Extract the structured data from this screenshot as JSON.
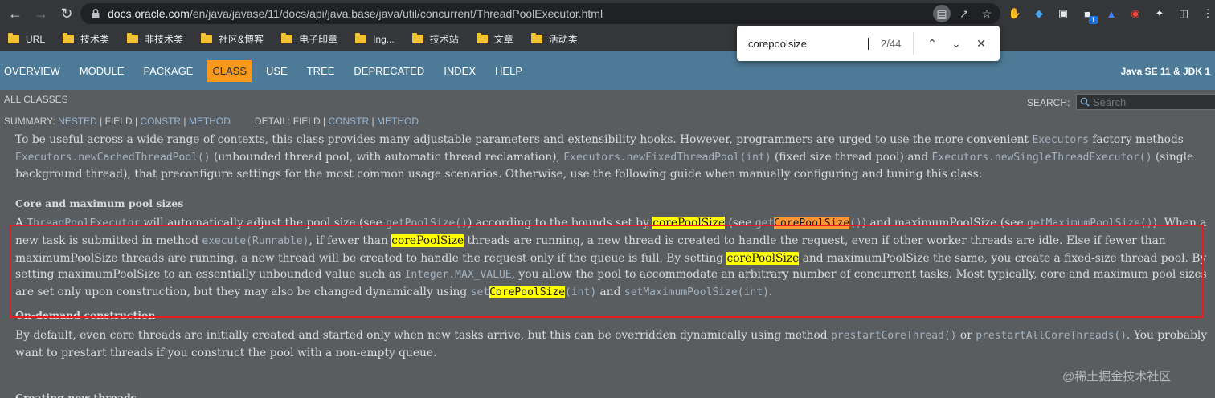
{
  "browser": {
    "url_host": "docs.oracle.com",
    "url_path": "/en/java/javase/11/docs/api/java.base/java/util/concurrent/ThreadPoolExecutor.html",
    "bookmarks": [
      "URL",
      "技术类",
      "非技术类",
      "社区&博客",
      "电子印章",
      "Ing...",
      "技术站",
      "文章",
      "活动类"
    ],
    "ext_badge": "1"
  },
  "find": {
    "query": "corepoolsize",
    "count": "2/44"
  },
  "nav": {
    "items": [
      "OVERVIEW",
      "MODULE",
      "PACKAGE",
      "CLASS",
      "USE",
      "TREE",
      "DEPRECATED",
      "INDEX",
      "HELP"
    ],
    "active": "CLASS",
    "title": "Java SE 11 & JDK 1"
  },
  "subnav": {
    "all_classes": "ALL CLASSES",
    "search_label": "SEARCH:",
    "search_placeholder": "Search",
    "summary_prefix": "SUMMARY: ",
    "summary_nested": "NESTED",
    "summary_field": "FIELD",
    "summary_constr": "CONSTR",
    "summary_method": "METHOD",
    "detail_prefix": "DETAIL: ",
    "detail_field": "FIELD",
    "detail_constr": "CONSTR",
    "detail_method": "METHOD"
  },
  "content": {
    "p1_a": "To be useful across a wide range of contexts, this class provides many adjustable parameters and extensibility hooks. However, programmers are urged to use the more convenient ",
    "p1_code1": "Executors",
    "p1_b": " factory methods ",
    "p1_code2": "Executors.newCachedThreadPool()",
    "p1_c": " (unbounded thread pool, with automatic thread reclamation), ",
    "p1_code3": "Executors.newFixedThreadPool(int)",
    "p1_d": " (fixed size thread pool) and ",
    "p1_code4": "Executors.newSingleThreadExecutor()",
    "p1_e": " (single background thread), that preconfigure settings for the most common usage scenarios. Otherwise, use the following guide when manually configuring and tuning this class:",
    "h_core": "Core and maximum pool sizes",
    "p2_a": "A ",
    "p2_code1": "ThreadPoolExecutor",
    "p2_b": " will automatically adjust the pool size (see ",
    "p2_code2": "getPoolSize()",
    "p2_c": ") according to the bounds set by ",
    "p2_hl1": "corePoolSize",
    "p2_d": " (see ",
    "p2_code3a": "get",
    "p2_hl2": "CorePoolSize",
    "p2_code3b": "()",
    "p2_e": ") and maximumPoolSize (see ",
    "p2_code4": "getMaximumPoolSize()",
    "p2_f": "). When a new task is submitted in method ",
    "p2_code5": "execute(Runnable)",
    "p2_g": ", if fewer than ",
    "p2_hl3": "corePoolSize",
    "p2_h": " threads are running, a new thread is created to handle the request, even if other worker threads are idle. Else if fewer than maximumPoolSize threads are running, a new thread will be created to handle the request only if the queue is full. By setting ",
    "p2_hl4": "corePoolSize",
    "p2_i": " and maximumPoolSize the same, you create a fixed-size thread pool. By setting maximumPoolSize to an essentially unbounded value such as ",
    "p2_code6": "Integer.MAX_VALUE",
    "p2_j": ", you allow the pool to accommodate an arbitrary number of concurrent tasks. Most typically, core and maximum pool sizes are set only upon construction, but they may also be changed dynamically using ",
    "p2_code7a": "set",
    "p2_hl5": "CorePoolSize",
    "p2_code7b": "(int)",
    "p2_k": " and ",
    "p2_code8": "setMaximumPoolSize(int)",
    "p2_l": ".",
    "h_ondemand": "On-demand construction",
    "p3_a": "By default, even core threads are initially created and started only when new tasks arrive, but this can be overridden dynamically using method ",
    "p3_code1": "prestartCoreThread()",
    "p3_b": " or ",
    "p3_code2": "prestartAllCoreThreads()",
    "p3_c": ". You probably want to prestart threads if you construct the pool with a non-empty queue.",
    "watermark": "@稀土掘金技术社区",
    "next_heading": "Creating new threads"
  }
}
